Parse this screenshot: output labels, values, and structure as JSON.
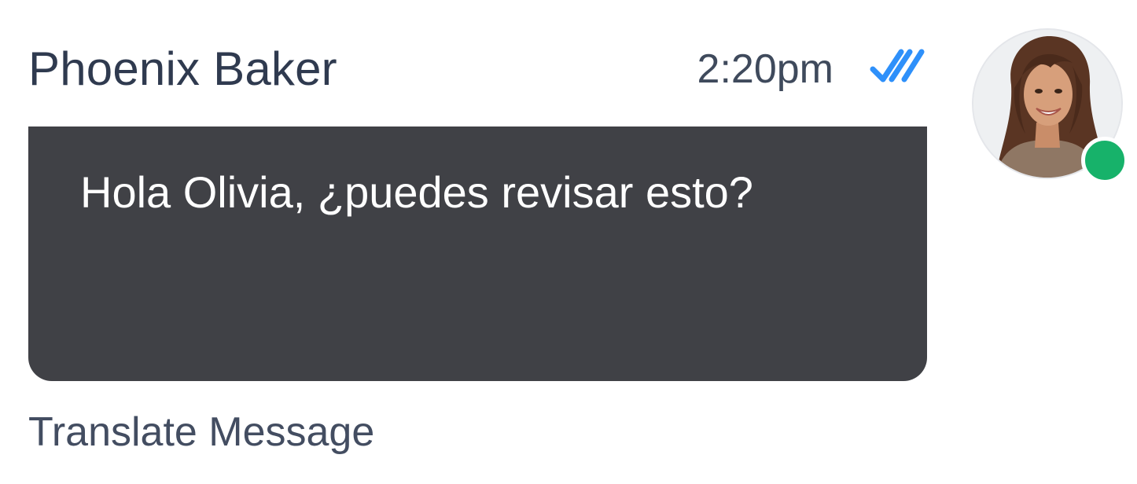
{
  "message": {
    "sender_name": "Phoenix Baker",
    "timestamp": "2:20pm",
    "read_status_icon": "double-check-icon",
    "text": "Hola Olivia, ¿puedes revisar esto?",
    "translate_label": "Translate Message"
  },
  "avatar": {
    "icon": "user-avatar-photo",
    "status": "online",
    "status_color": "#17b26a"
  },
  "colors": {
    "bubble": "#404146",
    "read_receipt": "#2e90fa",
    "name_text": "#2f3a4f"
  }
}
